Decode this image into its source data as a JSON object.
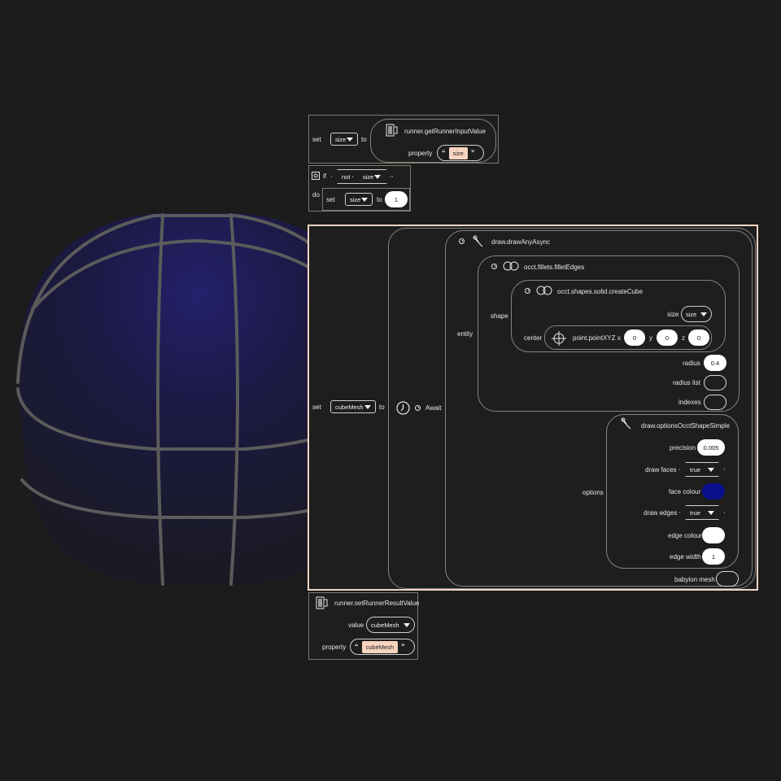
{
  "viewport": {
    "sphere_fill": "#1d1a3c",
    "grid_color": "#5d5d5d"
  },
  "blocks": {
    "set1": {
      "set": "set",
      "var": "size",
      "to": "to",
      "call": {
        "name": "runner.getRunnerInputValue",
        "property_label": "property",
        "property_value": "size"
      }
    },
    "if1": {
      "if": "if",
      "not": "not",
      "var": "size",
      "do": "do",
      "set": "set",
      "set_var": "size",
      "to": "to",
      "value": "1"
    },
    "set2": {
      "set": "set",
      "var": "cubeMesh",
      "to": "to",
      "await": "Await",
      "draw": {
        "name": "draw.drawAnyAsync",
        "entity_label": "entity",
        "fillet": {
          "name": "occt.fillets.filletEdges",
          "shape_label": "shape",
          "cube": {
            "name": "occt.shapes.solid.createCube",
            "size_label": "size",
            "size_var": "size",
            "center_label": "center",
            "point": {
              "name": "point.pointXYZ",
              "x_label": "x",
              "x": "0",
              "y_label": "y",
              "y": "0",
              "z_label": "z",
              "z": "0"
            }
          },
          "radius_label": "radius",
          "radius": "0.4",
          "radius_list_label": "radius list",
          "indexes_label": "indexes"
        },
        "options_label": "options",
        "options": {
          "name": "draw.optionsOcctShapeSimple",
          "precision_label": "precision",
          "precision": "0.005",
          "draw_faces_label": "draw faces",
          "draw_faces": "true",
          "face_colour_label": "face colour",
          "face_colour": "#0b0f8a",
          "draw_edges_label": "draw edges",
          "draw_edges": "true",
          "edge_colour_label": "edge colour",
          "edge_colour": "#ffffff",
          "edge_width_label": "edge width",
          "edge_width": "1"
        },
        "babylon_mesh_label": "babylon mesh"
      }
    },
    "result": {
      "name": "runner.setRunnerResultValue",
      "value_label": "value",
      "value_var": "cubeMesh",
      "property_label": "property",
      "property_value": "cubeMesh"
    }
  }
}
